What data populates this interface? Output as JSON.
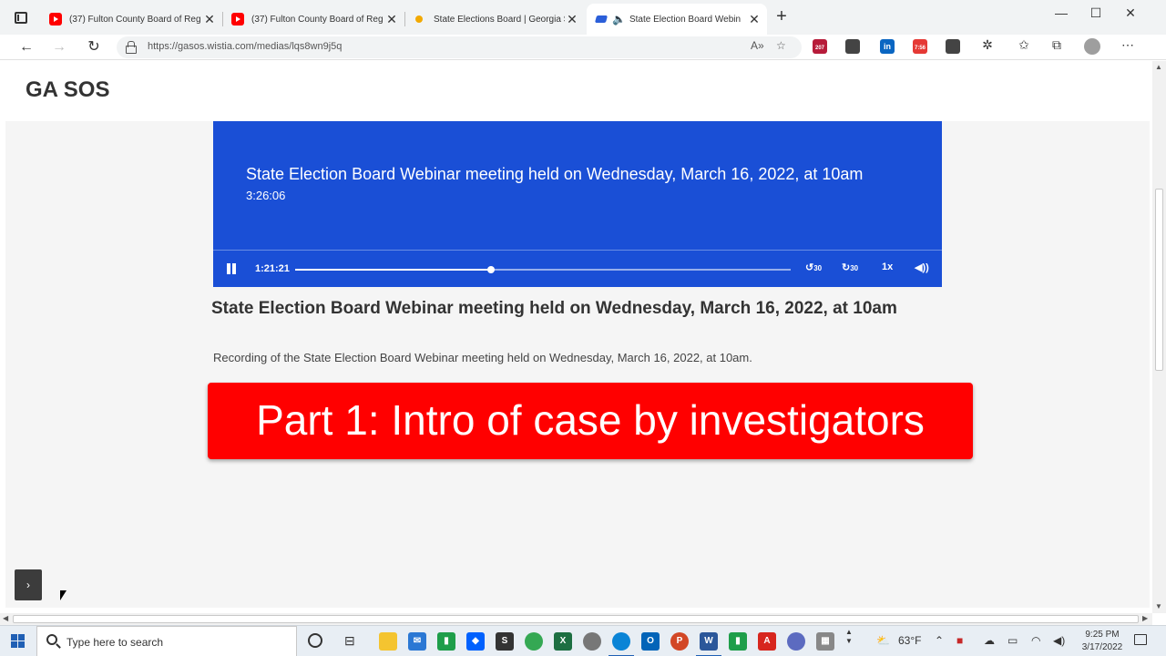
{
  "browser": {
    "tabs": [
      {
        "title": "(37) Fulton County Board of Reg",
        "icon": "youtube-icon"
      },
      {
        "title": "(37) Fulton County Board of Reg",
        "icon": "youtube-icon"
      },
      {
        "title": "State Elections Board | Georgia S",
        "icon": "georgia-sos-icon"
      },
      {
        "title": "State Election Board Webin",
        "icon": "wistia-icon",
        "active": true,
        "audio": "speaker-icon"
      }
    ],
    "close_glyph": "✕",
    "new_tab_glyph": "+",
    "window_controls": {
      "minimize": "—",
      "maximize": "☐",
      "close": "✕"
    },
    "url": "https://gasos.wistia.com/medias/lqs8wn9j5q",
    "extensions": {
      "badge_1": "207",
      "badge_2": "7:56"
    }
  },
  "page": {
    "site_title": "GA SOS",
    "player": {
      "title": "State Election Board Webinar meeting held on Wednesday, March 16, 2022, at 10am",
      "duration": "3:26:06",
      "current_time": "1:21:21",
      "progress": 0.395,
      "rewind_label": "30",
      "forward_label": "30",
      "speed": "1x"
    },
    "heading": "State Election Board Webinar meeting held on Wednesday, March 16, 2022, at 10am",
    "description": "Recording of the State Election Board Webinar meeting held on Wednesday, March 16, 2022, at 10am.",
    "banner": "Part 1: Intro of case by investigators",
    "side_toggle": "›"
  },
  "taskbar": {
    "search_placeholder": "Type here to search",
    "weather": "63°F",
    "time": "9:25 PM",
    "date": "3/17/2022"
  },
  "colors": {
    "player_bg": "#1a4fd6",
    "banner_bg": "#ff0000"
  }
}
